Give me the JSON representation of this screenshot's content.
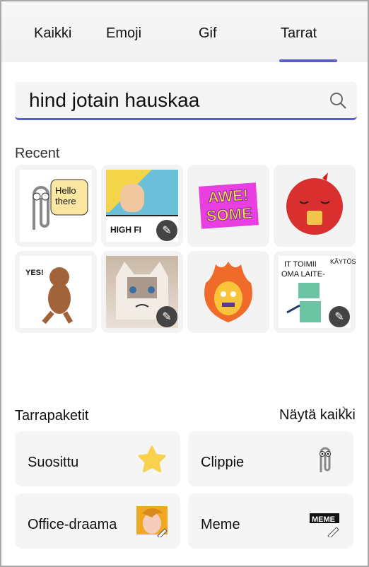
{
  "tabs": [
    {
      "label": "Kaikki"
    },
    {
      "label": "Emoji"
    },
    {
      "label": "Gif"
    },
    {
      "label": "Tarrat",
      "active": true
    }
  ],
  "search": {
    "value": "hind jotain hauskaa",
    "icon": "search-icon"
  },
  "recent": {
    "title": "Recent",
    "stickers": [
      {
        "name": "clippy-hello",
        "text": "Hello there"
      },
      {
        "name": "high-five",
        "text": "HIGH FI",
        "editable": true
      },
      {
        "name": "awesome",
        "text1": "AWE!",
        "text2": "SOME"
      },
      {
        "name": "red-monster-coffee"
      },
      {
        "name": "monkey-yes",
        "text": "YES!"
      },
      {
        "name": "grumpy-cat",
        "editable": true
      },
      {
        "name": "fire-character"
      },
      {
        "name": "robot-it",
        "text1": "IT TOIMII",
        "text2": "OMA LAITE-",
        "text3": "KÄYTÖSSÄ",
        "editable": true
      }
    ]
  },
  "packs": {
    "title": "Tarrapaketit",
    "see_all": "Näytä kaikki",
    "items": [
      {
        "label": "Suosittu",
        "icon": "star-icon"
      },
      {
        "label": "Clippie",
        "icon": "paperclip-icon"
      },
      {
        "label": "Office-draama",
        "icon": "comic-woman-icon"
      },
      {
        "label": "Meme",
        "icon": "meme-icon"
      }
    ]
  },
  "colors": {
    "accent": "#5b5fc7",
    "star": "#f8d14f"
  }
}
